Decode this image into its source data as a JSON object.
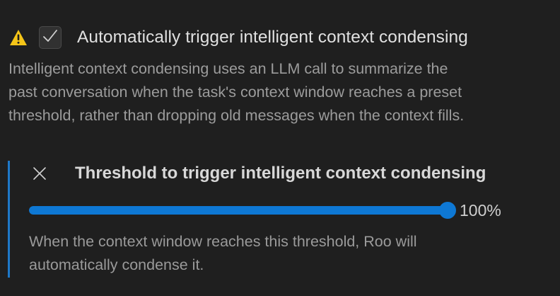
{
  "setting": {
    "warning_icon": "warning-icon",
    "checked": true,
    "check_icon": "check-icon",
    "title": "Automatically trigger intelligent context condensing",
    "description_lines": [
      "Intelligent context condensing uses an LLM call to summarize the",
      "past conversation when the task's context window reaches a preset",
      "threshold, rather than dropping old messages when the context fills."
    ]
  },
  "threshold": {
    "reset_icon": "close-icon",
    "title": "Threshold to trigger intelligent context condensing",
    "slider_value": 100,
    "slider_min": 0,
    "slider_max": 100,
    "value_label": "100%",
    "help_lines": [
      "When the context window reaches this threshold, Roo will",
      "automatically condense it."
    ]
  },
  "colors": {
    "accent": "#0e78d4",
    "warning": "#f5c518",
    "background": "#1f1f1f"
  }
}
